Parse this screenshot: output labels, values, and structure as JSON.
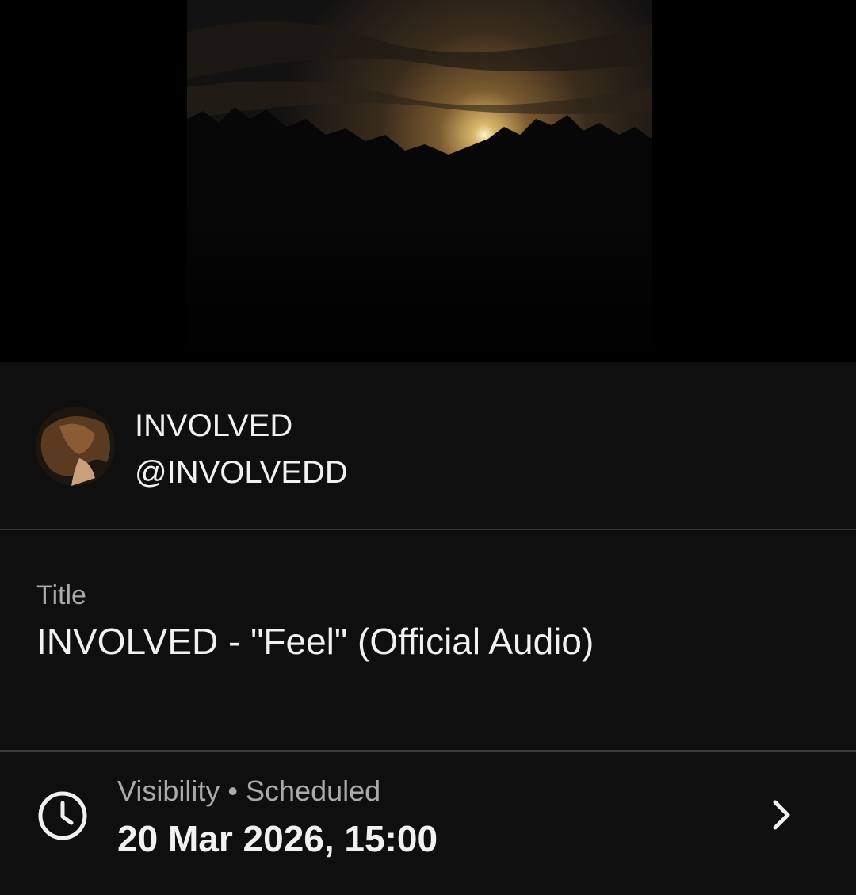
{
  "channel": {
    "name": "INVOLVED",
    "handle": "@INVOLVEDD",
    "avatar_icon": "avatar-photo"
  },
  "title_field": {
    "label": "Title",
    "value": "INVOLVED - \"Feel\" (Official Audio)"
  },
  "visibility": {
    "label": "Visibility",
    "separator": "•",
    "status": "Scheduled",
    "datetime": "20 Mar 2026, 15:00",
    "icon": "clock-icon",
    "action_icon": "chevron-right-icon"
  },
  "colors": {
    "background": "#0f0f0f",
    "text_primary": "#f1f1f1",
    "text_secondary": "#aaaaaa",
    "divider": "#3a3a3a"
  }
}
